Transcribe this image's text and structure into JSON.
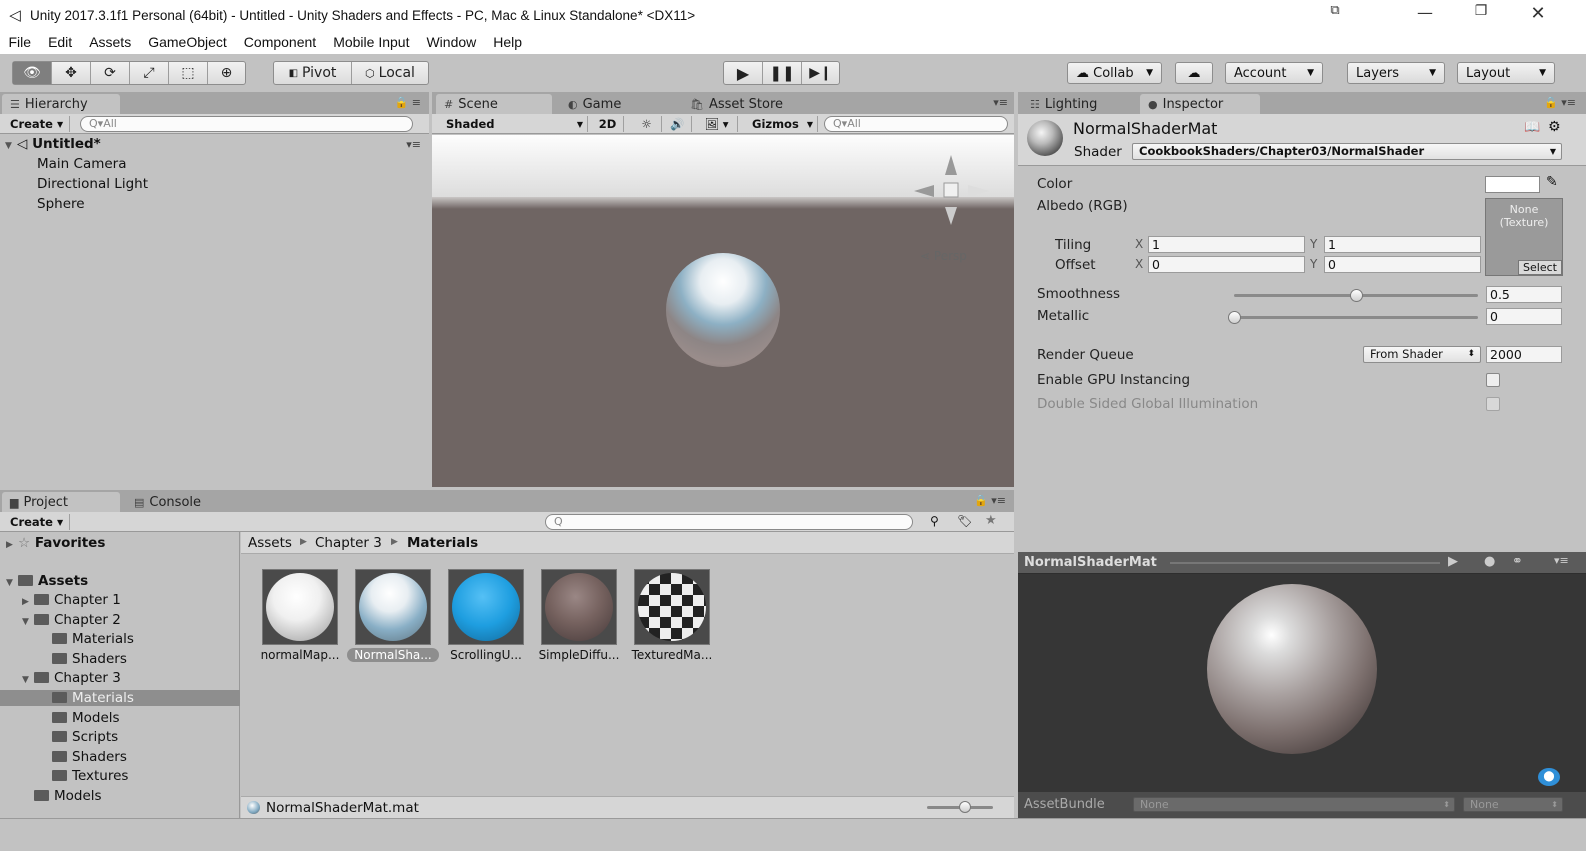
{
  "window": {
    "title": "Unity 2017.3.1f1 Personal (64bit) - Untitled - Unity Shaders and Effects - PC, Mac & Linux Standalone* <DX11>",
    "unity_icon": "unity-logo-icon"
  },
  "menu": [
    "File",
    "Edit",
    "Assets",
    "GameObject",
    "Component",
    "Mobile Input",
    "Window",
    "Help"
  ],
  "toolbar": {
    "tools": [
      "hand-icon",
      "move-icon",
      "rotate-icon",
      "scale-icon",
      "rect-icon",
      "transform-icon"
    ],
    "pivot": "Pivot",
    "local": "Local",
    "collab": "Collab",
    "account": "Account",
    "layers": "Layers",
    "layout": "Layout"
  },
  "hierarchy": {
    "tab": "Hierarchy",
    "create": "Create",
    "search": "All",
    "scene": "Untitled*",
    "items": [
      "Main Camera",
      "Directional Light",
      "Sphere"
    ]
  },
  "scene_view": {
    "tabs": [
      "Scene",
      "Game",
      "Asset Store"
    ],
    "shading": "Shaded",
    "mode2d": "2D",
    "gizmos": "Gizmos",
    "search": "All",
    "persp": "Persp"
  },
  "project": {
    "tabs": [
      "Project",
      "Console"
    ],
    "create": "Create",
    "favorites": "Favorites",
    "assets": "Assets",
    "tree": [
      {
        "label": "Chapter 1",
        "depth": 1,
        "expanded": false
      },
      {
        "label": "Chapter 2",
        "depth": 1,
        "expanded": true
      },
      {
        "label": "Materials",
        "depth": 2
      },
      {
        "label": "Shaders",
        "depth": 2
      },
      {
        "label": "Chapter 3",
        "depth": 1,
        "expanded": true
      },
      {
        "label": "Materials",
        "depth": 2,
        "selected": true
      },
      {
        "label": "Models",
        "depth": 2
      },
      {
        "label": "Scripts",
        "depth": 2
      },
      {
        "label": "Shaders",
        "depth": 2
      },
      {
        "label": "Textures",
        "depth": 2
      },
      {
        "label": "Models",
        "depth": 1
      }
    ],
    "breadcrumb": [
      "Assets",
      "Chapter 3",
      "Materials"
    ],
    "thumbnails": [
      {
        "name": "normalMap...",
        "style": "white"
      },
      {
        "name": "NormalSha...",
        "style": "blue-white",
        "selected": true
      },
      {
        "name": "ScrollingU...",
        "style": "blue"
      },
      {
        "name": "SimpleDiffu...",
        "style": "brown"
      },
      {
        "name": "TexturedMa...",
        "style": "checker"
      }
    ],
    "status_file": "NormalShaderMat.mat"
  },
  "inspector": {
    "tabs": [
      "Lighting",
      "Inspector"
    ],
    "material_name": "NormalShaderMat",
    "shader_label": "Shader",
    "shader": "CookbookShaders/Chapter03/NormalShader",
    "color_label": "Color",
    "albedo_label": "Albedo (RGB)",
    "texture_slot": "None\n(Texture)",
    "select": "Select",
    "tiling_label": "Tiling",
    "offset_label": "Offset",
    "tiling": {
      "x": "1",
      "y": "1"
    },
    "offset": {
      "x": "0",
      "y": "0"
    },
    "smoothness_label": "Smoothness",
    "smoothness": "0.5",
    "smoothness_fraction": 0.5,
    "metallic_label": "Metallic",
    "metallic": "0",
    "metallic_fraction": 0,
    "render_queue_label": "Render Queue",
    "render_queue_mode": "From Shader",
    "render_queue": "2000",
    "gpu_instancing_label": "Enable GPU Instancing",
    "double_sided_label": "Double Sided Global Illumination"
  },
  "preview": {
    "title": "NormalShaderMat",
    "assetbundle_label": "AssetBundle",
    "bundle_name": "None",
    "bundle_variant": "None"
  }
}
